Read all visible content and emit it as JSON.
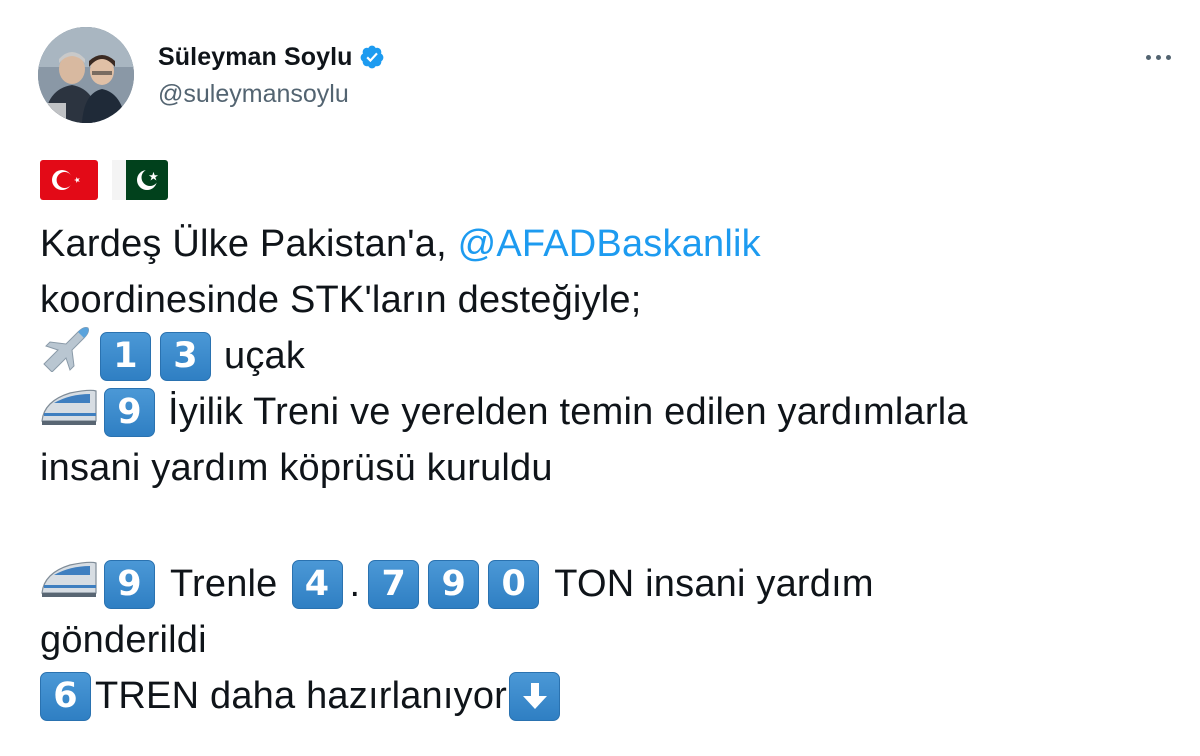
{
  "author": {
    "name": "Süleyman Soylu",
    "handle": "@suleymansoylu",
    "verified": true
  },
  "tweet": {
    "flags": [
      "flag-turkey",
      "flag-pakistan"
    ],
    "line1_text": "Kardeş Ülke Pakistan'a, ",
    "line1_mention": "@AFADBaskanlik",
    "line2": "koordinesinde STK'ların desteğiyle;",
    "line3_digits": [
      "1",
      "3"
    ],
    "line3_text": "uçak",
    "line4_digit": "9",
    "line4_text": "İyilik Treni ve yerelden temin edilen yardımlarla",
    "line5": "insani yardım köprüsü kuruldu",
    "line6_digit": "9",
    "line6_text_a": "Trenle",
    "line6_digits": [
      "4",
      "7",
      "9",
      "0"
    ],
    "line6_dot": ".",
    "line6_text_b": "TON insani yardım",
    "line7": "gönderildi",
    "line8_digit": "6",
    "line8_text": "TREN daha hazırlanıyor"
  },
  "icons": {
    "airplane": "airplane-icon",
    "train": "high-speed-train-icon",
    "down_arrow": "down-arrow-icon",
    "verified": "verified-badge-icon",
    "more": "more-options-icon"
  },
  "colors": {
    "accent": "#1d9bf0",
    "keycap": "#3a88cb",
    "text": "#0f1419",
    "secondary": "#536471"
  }
}
